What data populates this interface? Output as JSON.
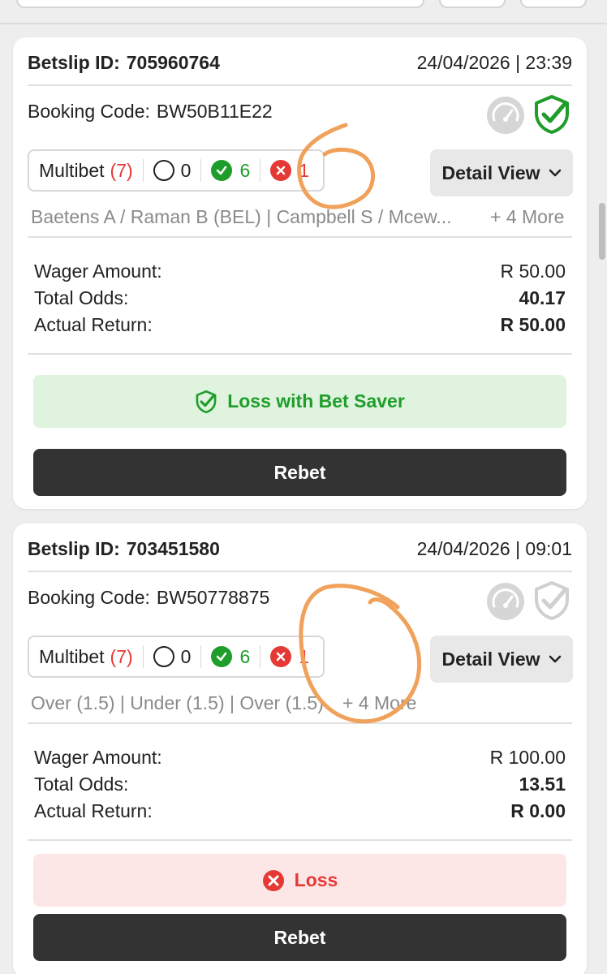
{
  "colors": {
    "green": "#1f9d2a",
    "red": "#e53935",
    "dark_button": "#333333",
    "scribble": "#f0a15a"
  },
  "bets": [
    {
      "betslip_label": "Betslip ID:",
      "betslip_id": "705960764",
      "datetime": "24/04/2026 | 23:39",
      "booking_label": "Booking Code:",
      "booking_code": "BW50B11E22",
      "icons": {
        "gauge": "gauge-icon",
        "shield": "shield-check-icon",
        "shield_active": true
      },
      "bet_type": "Multibet",
      "bet_count": "(7)",
      "open_count": "0",
      "won_count": "6",
      "lost_count": "1",
      "detail_label": "Detail View",
      "selections": "Baetens A / Raman B (BEL) | Campbell S / Mcew...",
      "more": "+ 4 More",
      "wager_label": "Wager Amount:",
      "wager_value": "R 50.00",
      "odds_label": "Total Odds:",
      "odds_value": "40.17",
      "return_label": "Actual Return:",
      "return_value": "R 50.00",
      "status_text": "Loss with Bet Saver",
      "status_icon": "shield-check-icon",
      "rebet_label": "Rebet"
    },
    {
      "betslip_label": "Betslip ID:",
      "betslip_id": "703451580",
      "datetime": "24/04/2026 | 09:01",
      "booking_label": "Booking Code:",
      "booking_code": "BW50778875",
      "icons": {
        "gauge": "gauge-icon",
        "shield": "shield-check-icon",
        "shield_active": false
      },
      "bet_type": "Multibet",
      "bet_count": "(7)",
      "open_count": "0",
      "won_count": "6",
      "lost_count": "1",
      "detail_label": "Detail View",
      "selections": "Over (1.5) | Under (1.5) | Over (1.5)",
      "more": "+ 4 More",
      "wager_label": "Wager Amount:",
      "wager_value": "R 100.00",
      "odds_label": "Total Odds:",
      "odds_value": "13.51",
      "return_label": "Actual Return:",
      "return_value": "R 0.00",
      "status_text": "Loss",
      "status_icon": "x-circle-icon",
      "rebet_label": "Rebet"
    }
  ]
}
